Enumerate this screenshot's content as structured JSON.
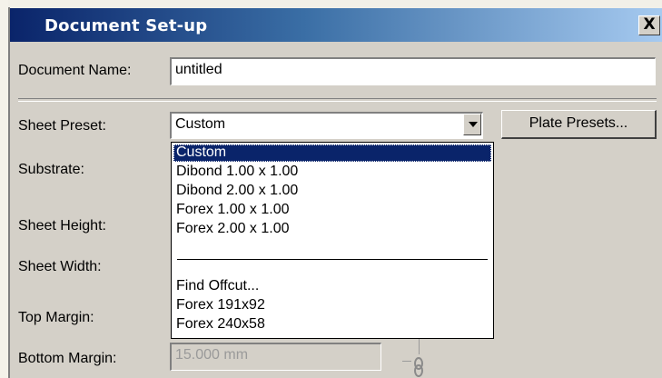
{
  "window": {
    "title": "Document Set-up",
    "close_label": "X"
  },
  "fields": {
    "document_name_label": "Document Name:",
    "document_name_value": "untitled",
    "sheet_preset_label": "Sheet Preset:",
    "sheet_preset_value": "Custom",
    "plate_presets_label": "Plate Presets...",
    "substrate_label": "Substrate:",
    "sheet_height_label": "Sheet Height:",
    "sheet_width_label": "Sheet Width:",
    "top_margin_label": "Top Margin:",
    "bottom_margin_label": "Bottom Margin:",
    "bottom_margin_value": "15.000 mm"
  },
  "preset_dropdown": {
    "selected": "Custom",
    "items": [
      "Custom",
      "Dibond 1.00 x 1.00",
      "Dibond 2.00 x 1.00",
      "Forex 1.00 x 1.00",
      "Forex 2.00 x 1.00",
      "Find Offcut...",
      "Forex 191x92",
      "Forex 240x58"
    ]
  },
  "colors": {
    "title_start": "#0a246a",
    "title_end": "#a6caf0",
    "selection": "#0a246a",
    "dialog_bg": "#d4d0c8"
  },
  "icons": {
    "close": "close-icon",
    "dropdown_arrow": "chevron-down-icon",
    "link": "chain-link-icon"
  }
}
